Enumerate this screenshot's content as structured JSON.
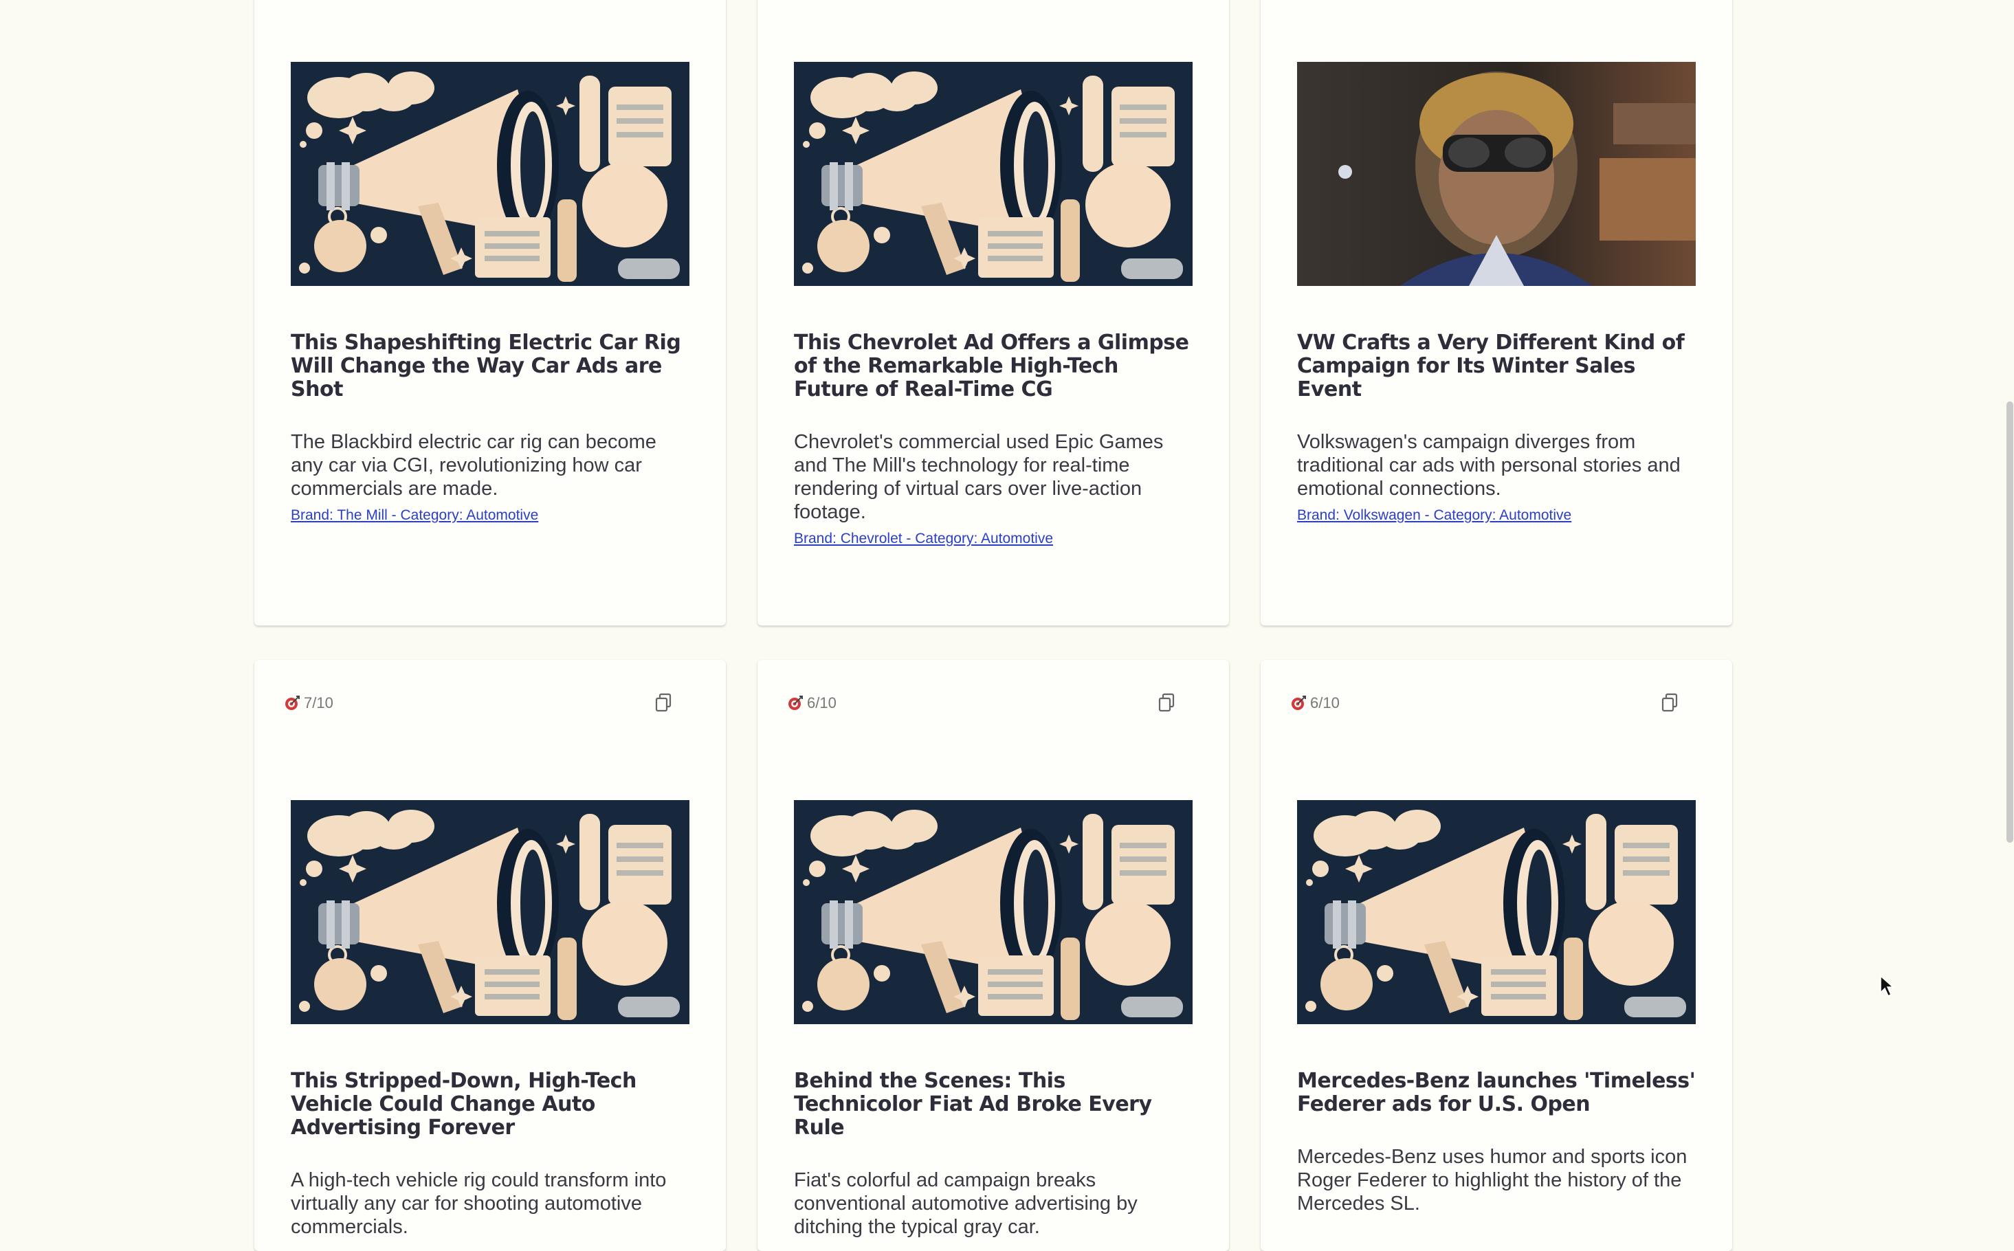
{
  "cards": [
    {
      "image": "megaphone-illustration",
      "title": "This Shapeshifting Electric Car Rig Will Change the Way Car Ads are Shot",
      "description": "The Blackbird electric car rig can become any car via CGI, revolutionizing how car commercials are made.",
      "tag": "Brand: The Mill - Category: Automotive"
    },
    {
      "image": "megaphone-illustration",
      "title": "This Chevrolet Ad Offers a Glimpse of the Remarkable High-Tech Future of Real-Time CG",
      "description": "Chevrolet's commercial used Epic Games and The Mill's technology for real-time rendering of virtual cars over live-action footage.",
      "tag": "Brand: Chevrolet - Category: Automotive"
    },
    {
      "image": "driver-in-helmet-photo",
      "title": "VW Crafts a Very Different Kind of Campaign for Its Winter Sales Event",
      "description": "Volkswagen's campaign diverges from traditional car ads with personal stories and emotional connections.",
      "tag": "Brand: Volkswagen - Category: Automotive"
    },
    {
      "rating": "7/10",
      "image": "megaphone-illustration",
      "title": "This Stripped-Down, High-Tech Vehicle Could Change Auto Advertising Forever",
      "description": "A high-tech vehicle rig could transform into virtually any car for shooting automotive commercials."
    },
    {
      "rating": "6/10",
      "image": "megaphone-illustration",
      "title": "Behind the Scenes: This Technicolor Fiat Ad Broke Every Rule",
      "description": "Fiat's colorful ad campaign breaks conventional automotive advertising by ditching the typical gray car."
    },
    {
      "rating": "6/10",
      "image": "megaphone-illustration",
      "title": "Mercedes-Benz launches 'Timeless' Federer ads for U.S. Open",
      "description": "Mercedes-Benz uses humor and sports icon Roger Federer to highlight the history of the Mercedes SL."
    }
  ],
  "icons": {
    "rating": "target-icon",
    "copy": "copy-icon"
  },
  "colors": {
    "background": "#fbfbf2",
    "link": "#2b3fc6",
    "illustration_navy": "#17283c",
    "illustration_cream": "#f3d9bb"
  }
}
